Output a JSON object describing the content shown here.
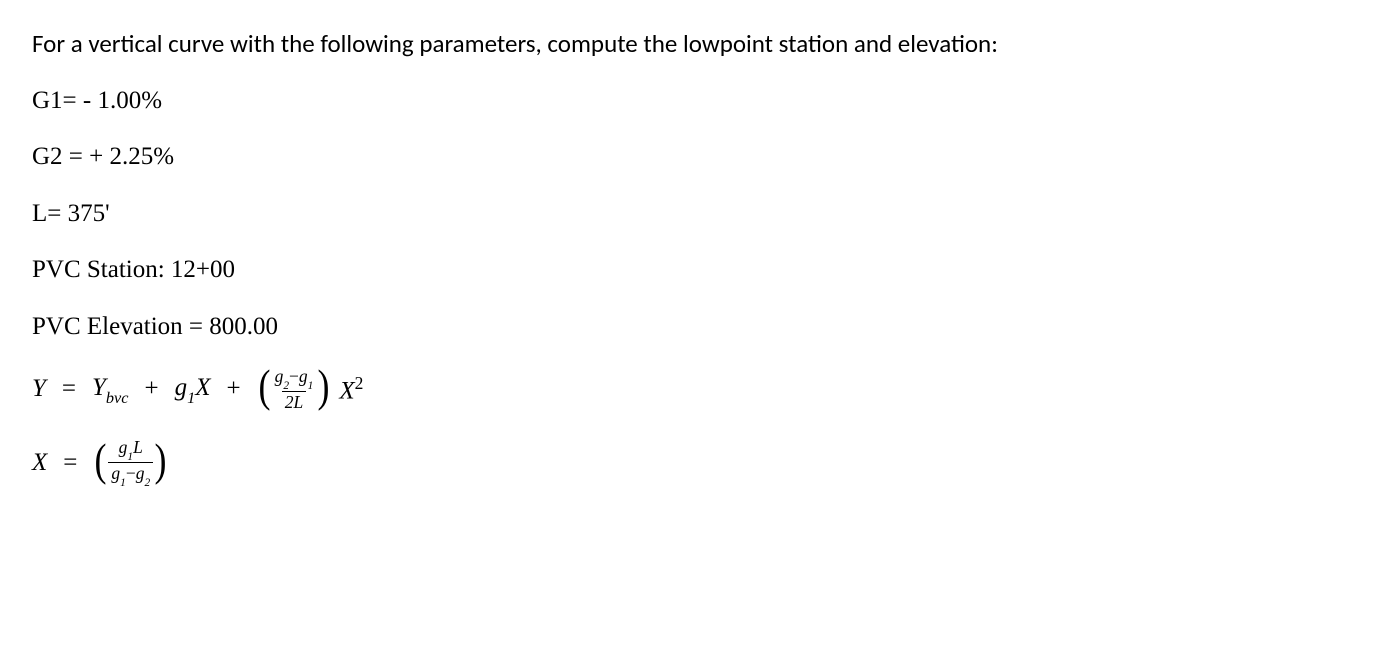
{
  "problem": {
    "intro": "For a vertical curve with the following parameters, compute the lowpoint station and elevation:",
    "params": {
      "g1": "G1= - 1.00%",
      "g2": "G2 = + 2.25%",
      "L": "L= 375'",
      "pvc_station": "PVC Station: 12+00",
      "pvc_elevation": "PVC Elevation = 800.00"
    },
    "formulas": {
      "y": {
        "lhs": "Y",
        "term1_base": "Y",
        "term1_sub": "bvc",
        "term2_coef": "g",
        "term2_sub": "1",
        "term2_var": "X",
        "frac_num_a": "g",
        "frac_num_a_sub": "2",
        "frac_num_minus": "−",
        "frac_num_b": "g",
        "frac_num_b_sub": "1",
        "frac_den": "2L",
        "term3_var": "X",
        "term3_sup": "2"
      },
      "x": {
        "lhs": "X",
        "frac_num_a": "g",
        "frac_num_a_sub": "1",
        "frac_num_b": "L",
        "frac_den_a": "g",
        "frac_den_a_sub": "1",
        "frac_den_minus": "−",
        "frac_den_b": "g",
        "frac_den_b_sub": "2"
      }
    }
  }
}
